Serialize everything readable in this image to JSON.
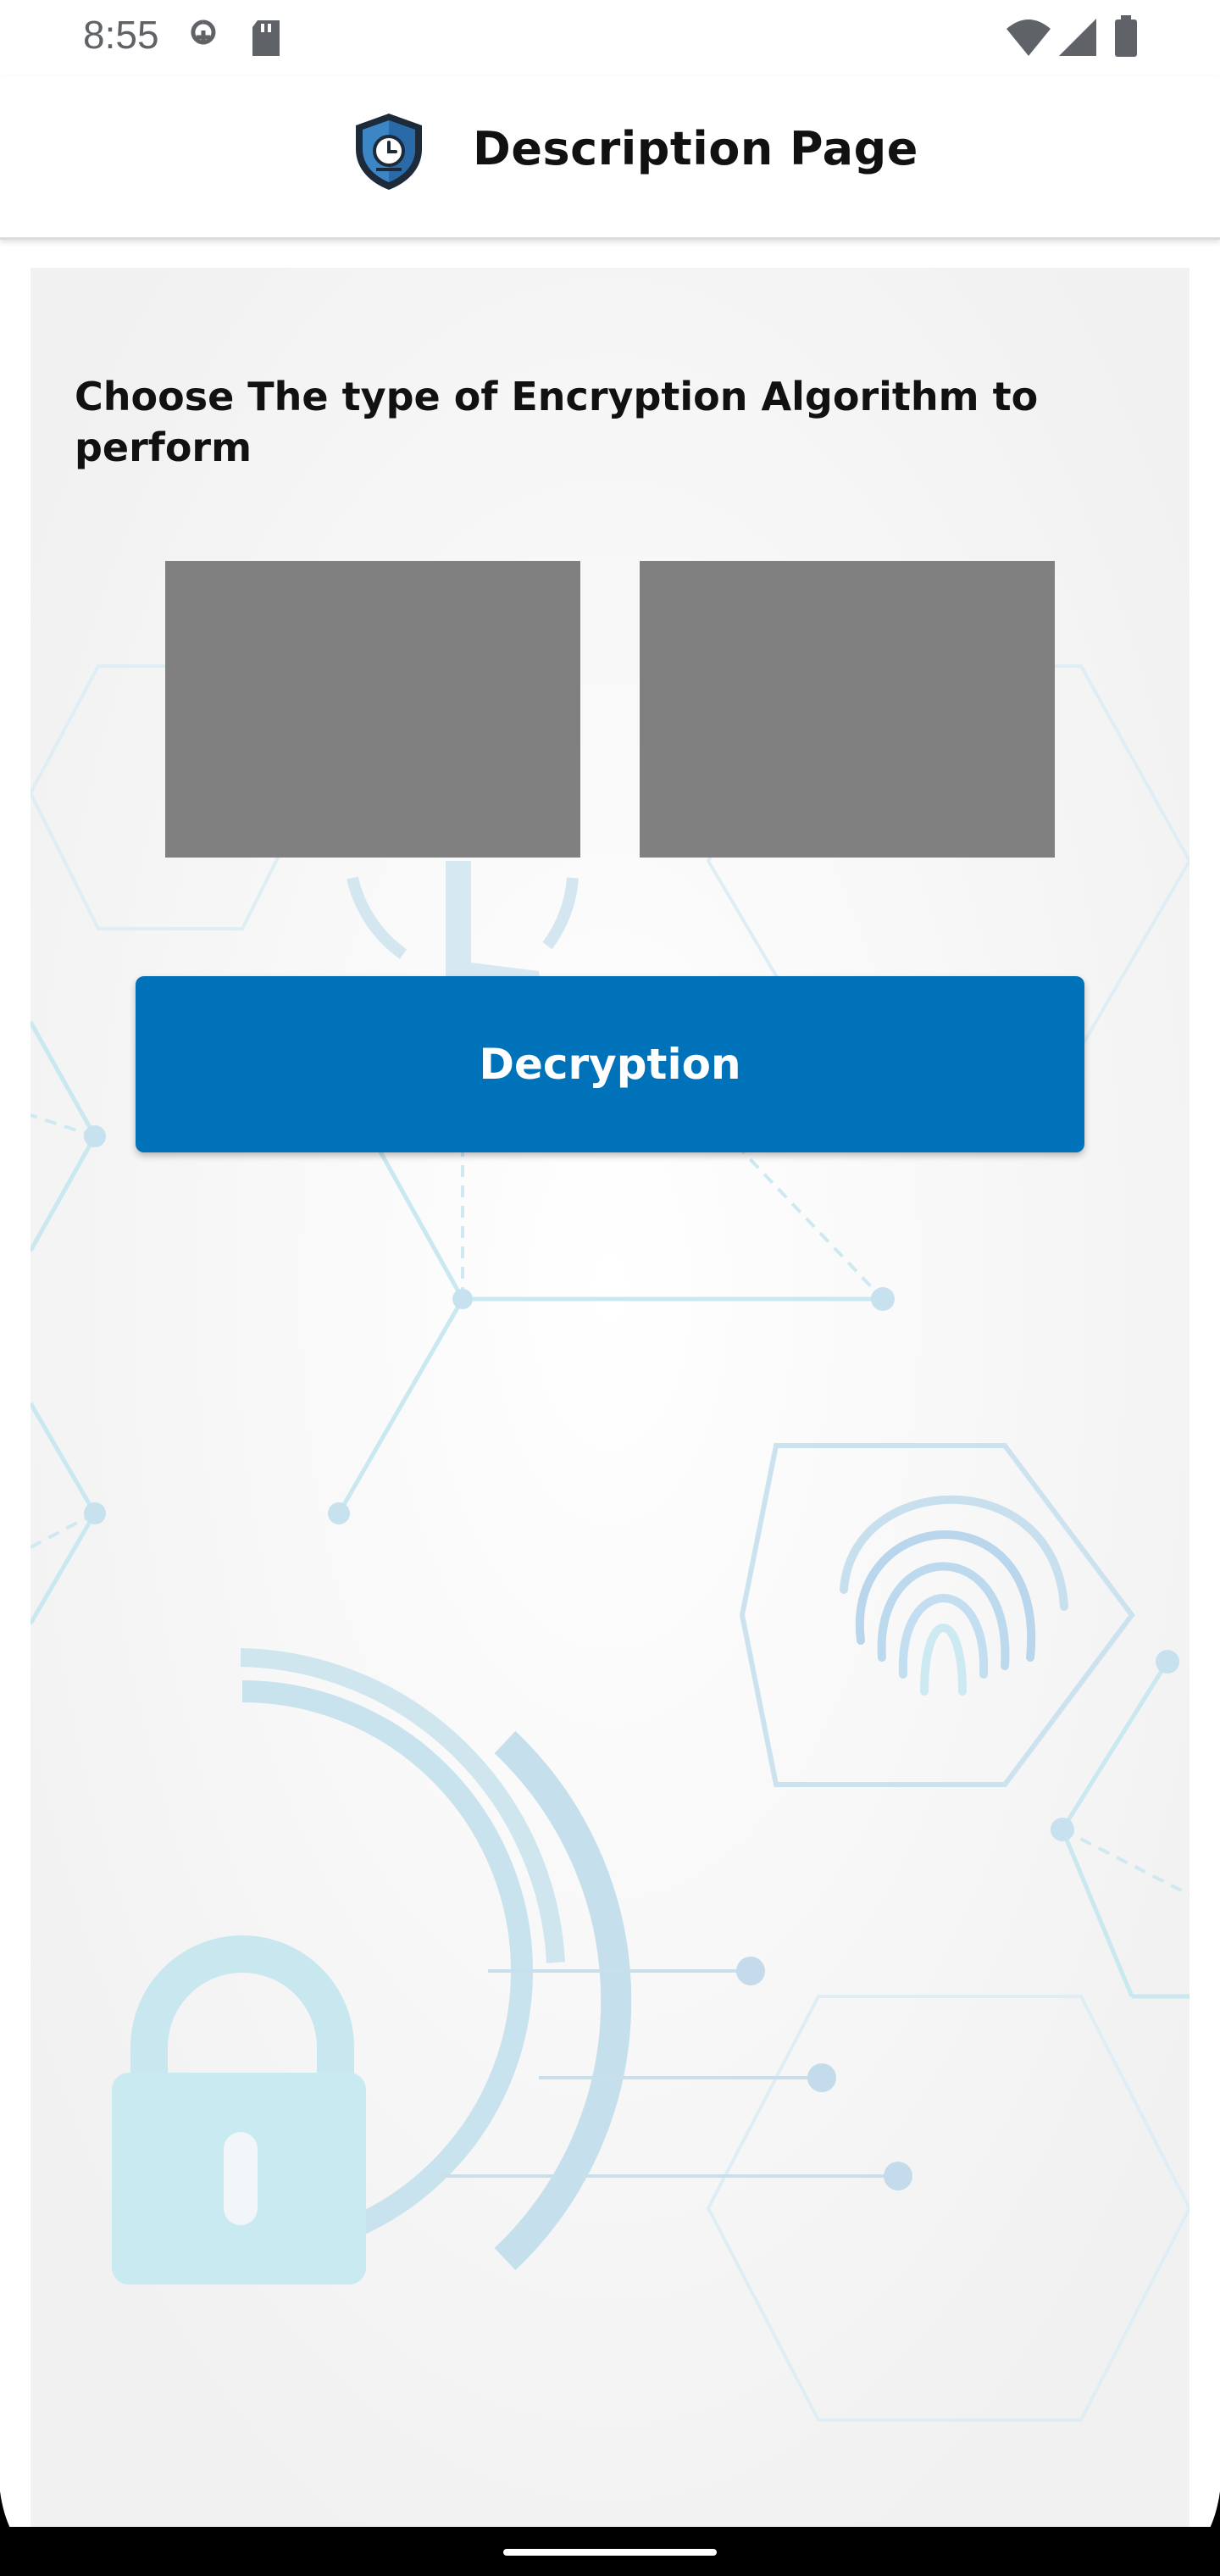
{
  "status_bar": {
    "time": "8:55",
    "icons": [
      "sim-activity-icon",
      "sd-card-icon",
      "wifi-icon",
      "cellular-signal-icon",
      "battery-icon"
    ]
  },
  "app_bar": {
    "title": "Description Page",
    "logo_icon": "shield-clock-icon"
  },
  "main": {
    "headline": "Choose The type of Encryption Algorithm to perform",
    "option_cards": [
      {
        "name": "algorithm-option-1"
      },
      {
        "name": "algorithm-option-2"
      }
    ],
    "primary_button_label": "Decryption"
  },
  "colors": {
    "primary": "#0072b9",
    "card_placeholder": "#808080",
    "panel_bg": "#f1f1f1",
    "accent_light_blue": "#bfe6f2"
  }
}
